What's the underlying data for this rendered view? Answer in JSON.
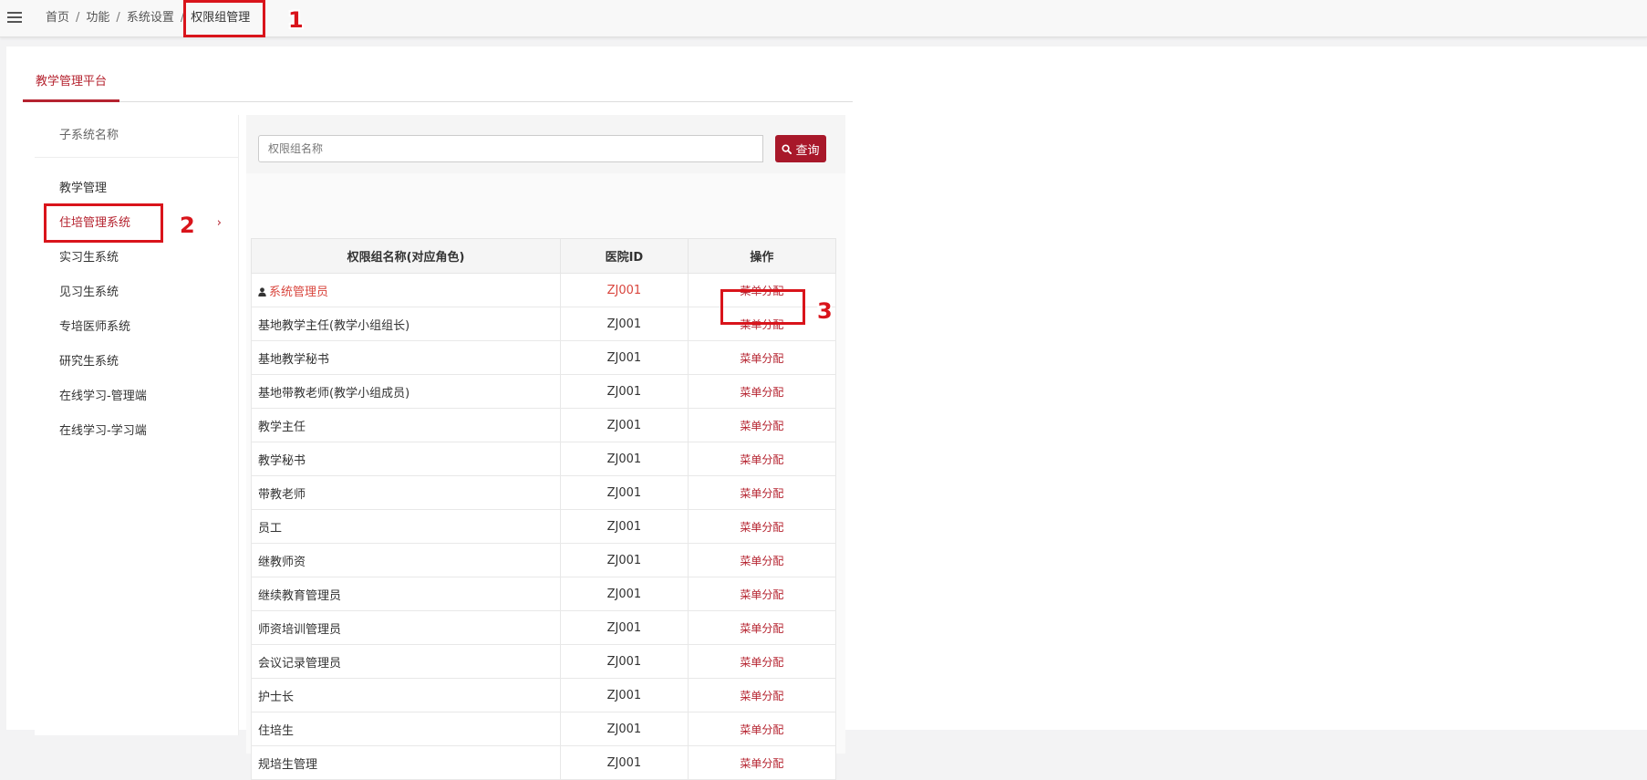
{
  "breadcrumb": {
    "items": [
      "首页",
      "功能",
      "系统设置",
      "权限组管理"
    ],
    "separator": "/"
  },
  "platform_tab": "教学管理平台",
  "sidebar": {
    "header": "子系统名称",
    "items": [
      {
        "label": "教学管理"
      },
      {
        "label": "住培管理系统",
        "active": true
      },
      {
        "label": "实习生系统"
      },
      {
        "label": "见习生系统"
      },
      {
        "label": "专培医师系统"
      },
      {
        "label": "研究生系统"
      },
      {
        "label": "在线学习-管理端"
      },
      {
        "label": "在线学习-学习端"
      }
    ],
    "chevron": "›"
  },
  "search": {
    "placeholder": "权限组名称",
    "button_label": "查询"
  },
  "table": {
    "columns": [
      "权限组名称(对应角色)",
      "医院ID",
      "操作"
    ],
    "rows": [
      {
        "name": "系统管理员",
        "hospital_id": "ZJ001",
        "action": "菜单分配",
        "highlight": true
      },
      {
        "name": "基地教学主任(教学小组组长)",
        "hospital_id": "ZJ001",
        "action": "菜单分配"
      },
      {
        "name": "基地教学秘书",
        "hospital_id": "ZJ001",
        "action": "菜单分配"
      },
      {
        "name": "基地带教老师(教学小组成员)",
        "hospital_id": "ZJ001",
        "action": "菜单分配"
      },
      {
        "name": "教学主任",
        "hospital_id": "ZJ001",
        "action": "菜单分配"
      },
      {
        "name": "教学秘书",
        "hospital_id": "ZJ001",
        "action": "菜单分配"
      },
      {
        "name": "带教老师",
        "hospital_id": "ZJ001",
        "action": "菜单分配"
      },
      {
        "name": "员工",
        "hospital_id": "ZJ001",
        "action": "菜单分配"
      },
      {
        "name": "继教师资",
        "hospital_id": "ZJ001",
        "action": "菜单分配"
      },
      {
        "name": "继续教育管理员",
        "hospital_id": "ZJ001",
        "action": "菜单分配"
      },
      {
        "name": "师资培训管理员",
        "hospital_id": "ZJ001",
        "action": "菜单分配"
      },
      {
        "name": "会议记录管理员",
        "hospital_id": "ZJ001",
        "action": "菜单分配"
      },
      {
        "name": "护士长",
        "hospital_id": "ZJ001",
        "action": "菜单分配"
      },
      {
        "name": "住培生",
        "hospital_id": "ZJ001",
        "action": "菜单分配"
      },
      {
        "name": "规培生管理",
        "hospital_id": "ZJ001",
        "action": "菜单分配"
      }
    ]
  },
  "annotations": [
    "1",
    "2",
    "3"
  ],
  "colors": {
    "accent": "#b5232f",
    "annotation": "#d9141b",
    "search_button": "#a8182a"
  }
}
